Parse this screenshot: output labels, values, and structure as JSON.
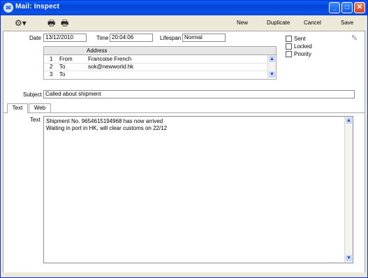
{
  "window": {
    "title": "Mail: Inspect"
  },
  "toolbar": {
    "new_label": "New",
    "duplicate_label": "Duplicate",
    "cancel_label": "Cancel",
    "save_label": "Save"
  },
  "header": {
    "date_label": "Date",
    "date_value": "13/12/2010",
    "time_label": "Time",
    "time_value": "20:04:06",
    "lifespan_label": "Lifespan",
    "lifespan_value": "Normal"
  },
  "flags": [
    {
      "label": "Sent",
      "checked": false
    },
    {
      "label": "Locked",
      "checked": false
    },
    {
      "label": "Priority",
      "checked": false
    }
  ],
  "addresses": {
    "column_address": "Address",
    "rows": [
      {
        "num": "1",
        "type": "From",
        "address": "Francoise French"
      },
      {
        "num": "2",
        "type": "To",
        "address": "sok@newworld.hk"
      },
      {
        "num": "3",
        "type": "To",
        "address": ""
      }
    ]
  },
  "subject": {
    "label": "Subject",
    "value": "Called about shipment"
  },
  "tabs": [
    {
      "label": "Text",
      "active": true
    },
    {
      "label": "Web",
      "active": false
    }
  ],
  "body": {
    "label": "Text",
    "lines": [
      "Shipment No. 9654615194968 has now arrived",
      "Waiting in port in HK, will clear customs on 22/12"
    ]
  }
}
